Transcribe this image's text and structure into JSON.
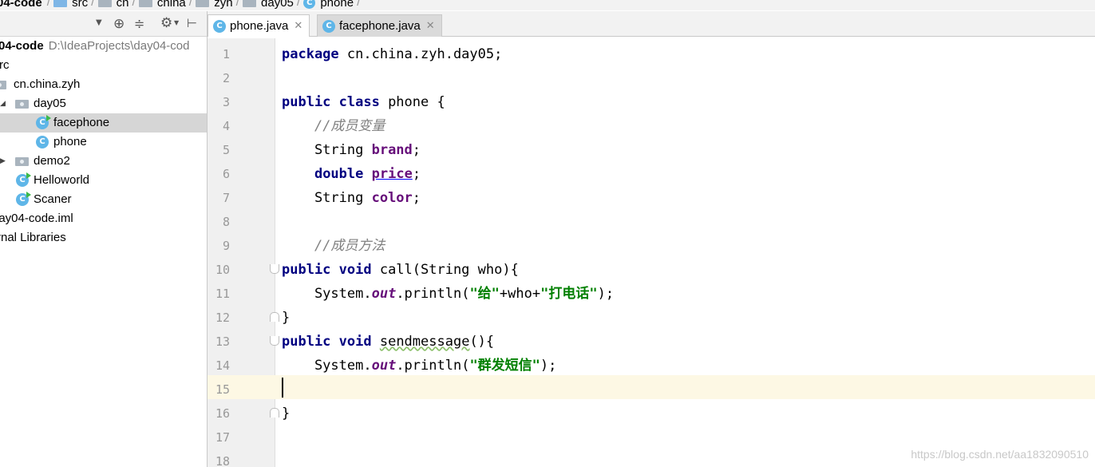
{
  "breadcrumb": [
    "04-code",
    "src",
    "cn",
    "china",
    "zyh",
    "day05",
    "phone"
  ],
  "project": {
    "root_name": "04-code",
    "root_path": "D:\\IdeaProjects\\day04-cod",
    "nodes": [
      "rc",
      "cn.china.zyh",
      "day05",
      "facephone",
      "phone",
      "demo2",
      "Helloworld",
      "Scaner",
      "lay04-code.iml",
      "rnal Libraries"
    ]
  },
  "tabs": [
    {
      "label": "phone.java",
      "active": true
    },
    {
      "label": "facephone.java",
      "active": false
    }
  ],
  "editor": {
    "line_numbers": [
      "1",
      "2",
      "3",
      "4",
      "5",
      "6",
      "7",
      "8",
      "9",
      "10",
      "11",
      "12",
      "13",
      "14",
      "15",
      "16",
      "17",
      "18"
    ],
    "current_line": 15,
    "lines": [
      [
        {
          "t": "package",
          "c": "kw"
        },
        {
          "t": " cn.china.zyh.day05;",
          "c": ""
        }
      ],
      [],
      [
        {
          "t": "public class",
          "c": "kw"
        },
        {
          "t": " phone {",
          "c": ""
        }
      ],
      [
        {
          "t": "    ",
          "c": ""
        },
        {
          "t": "//成员变量",
          "c": "cm"
        }
      ],
      [
        {
          "t": "    String ",
          "c": ""
        },
        {
          "t": "brand",
          "c": "fld"
        },
        {
          "t": ";",
          "c": ""
        }
      ],
      [
        {
          "t": "    ",
          "c": ""
        },
        {
          "t": "double",
          "c": "kw"
        },
        {
          "t": " ",
          "c": ""
        },
        {
          "t": "price",
          "c": "ul"
        },
        {
          "t": ";",
          "c": ""
        }
      ],
      [
        {
          "t": "    String ",
          "c": ""
        },
        {
          "t": "color",
          "c": "fld"
        },
        {
          "t": ";",
          "c": ""
        }
      ],
      [],
      [
        {
          "t": "    ",
          "c": ""
        },
        {
          "t": "//成员方法",
          "c": "cm"
        }
      ],
      [
        {
          "t": "public void",
          "c": "kw"
        },
        {
          "t": " call(String who){",
          "c": ""
        }
      ],
      [
        {
          "t": "    System.",
          "c": ""
        },
        {
          "t": "out",
          "c": "sf"
        },
        {
          "t": ".println(",
          "c": ""
        },
        {
          "t": "\"给\"",
          "c": "st"
        },
        {
          "t": "+who+",
          "c": ""
        },
        {
          "t": "\"打电话\"",
          "c": "st"
        },
        {
          "t": ");",
          "c": ""
        }
      ],
      [
        {
          "t": "}",
          "c": ""
        }
      ],
      [
        {
          "t": "public void",
          "c": "kw"
        },
        {
          "t": " ",
          "c": ""
        },
        {
          "t": "sendmessage",
          "c": "wavy"
        },
        {
          "t": "(){",
          "c": ""
        }
      ],
      [
        {
          "t": "    System.",
          "c": ""
        },
        {
          "t": "out",
          "c": "sf"
        },
        {
          "t": ".println(",
          "c": ""
        },
        {
          "t": "\"群发短信\"",
          "c": "st"
        },
        {
          "t": ");",
          "c": ""
        }
      ],
      [],
      [
        {
          "t": "}",
          "c": ""
        }
      ],
      [],
      []
    ]
  },
  "watermark": "https://blog.csdn.net/aa1832090510"
}
